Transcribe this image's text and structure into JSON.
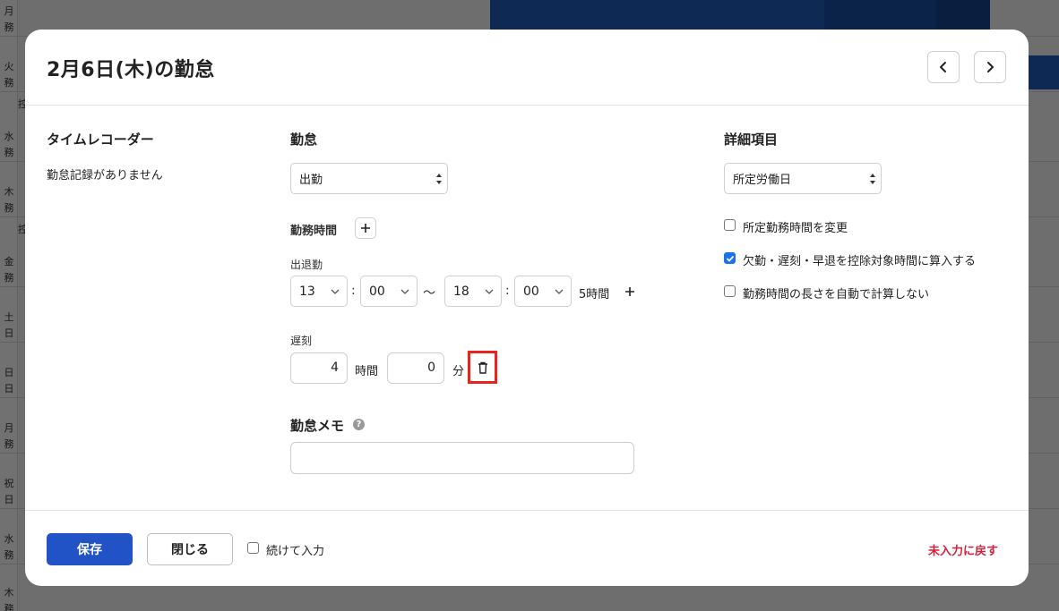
{
  "background": {
    "day_labels": [
      "月\n務",
      "火\n務",
      "水\n務",
      "木\n務",
      "金\n務",
      "土\n日",
      "日\n日",
      "月\n務",
      "祝\n日",
      "水\n務",
      "木\n務"
    ],
    "side_marks": [
      "控",
      "控"
    ]
  },
  "modal": {
    "title": "2月6日(木)の勤怠",
    "prev_icon": "chevron-left-icon",
    "next_icon": "chevron-right-icon"
  },
  "time_recorder": {
    "heading": "タイムレコーダー",
    "message": "勤怠記録がありません"
  },
  "attendance": {
    "heading": "勤怠",
    "type_value": "出勤",
    "work_time_label": "勤務時間",
    "clock_label": "出退勤",
    "start_hour": "13",
    "start_minute": "00",
    "range_sep": "〜",
    "colon": ":",
    "end_hour": "18",
    "end_minute": "00",
    "duration": "5時間",
    "late_label": "遅刻",
    "late_hours": "4",
    "hours_unit": "時間",
    "late_minutes": "0",
    "minutes_unit": "分",
    "memo_label": "勤怠メモ",
    "memo_value": ""
  },
  "details": {
    "heading": "詳細項目",
    "day_type_value": "所定労働日",
    "options": [
      {
        "label": "所定勤務時間を変更",
        "checked": false
      },
      {
        "label": "欠勤・遅刻・早退を控除対象時間に算入する",
        "checked": true
      },
      {
        "label": "勤務時間の長さを自動で計算しない",
        "checked": false
      }
    ]
  },
  "footer": {
    "save_label": "保存",
    "close_label": "閉じる",
    "continue_label": "続けて入力",
    "reset_label": "未入力に戻す"
  },
  "colors": {
    "primary": "#2153c6",
    "danger": "#d3213b",
    "highlight": "#e8231f"
  }
}
